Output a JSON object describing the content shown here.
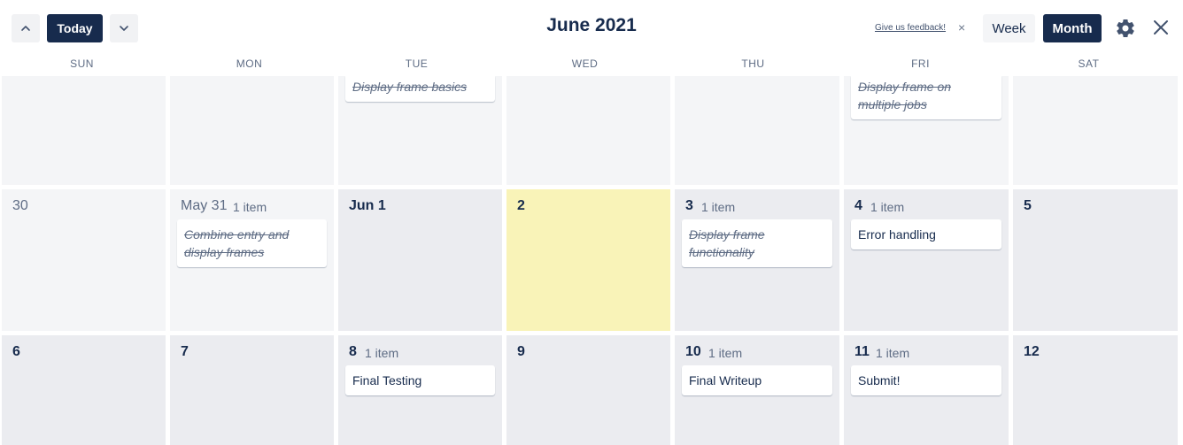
{
  "header": {
    "today_label": "Today",
    "title": "June 2021",
    "feedback_label": "Give us feedback!",
    "feedback_close": "×",
    "week_label": "Week",
    "month_label": "Month"
  },
  "weekdays": [
    "SUN",
    "MON",
    "TUE",
    "WED",
    "THU",
    "FRI",
    "SAT"
  ],
  "week1": {
    "tue_card": "Display frame basics",
    "fri_card": "Display frame on multiple jobs"
  },
  "week2": {
    "sun": {
      "date": "30"
    },
    "mon": {
      "date": "May 31",
      "count": "1 item",
      "card": "Combine entry and display frames"
    },
    "tue": {
      "date": "Jun 1"
    },
    "wed": {
      "date": "2"
    },
    "thu": {
      "date": "3",
      "count": "1 item",
      "card": "Display frame functionality"
    },
    "fri": {
      "date": "4",
      "count": "1 item",
      "card": "Error handling"
    },
    "sat": {
      "date": "5"
    }
  },
  "week3": {
    "sun": {
      "date": "6"
    },
    "mon": {
      "date": "7"
    },
    "tue": {
      "date": "8",
      "count": "1 item",
      "card": "Final Testing"
    },
    "wed": {
      "date": "9"
    },
    "thu": {
      "date": "10",
      "count": "1 item",
      "card": "Final Writeup"
    },
    "fri": {
      "date": "11",
      "count": "1 item",
      "card": "Submit!"
    },
    "sat": {
      "date": "12"
    }
  },
  "colors": {
    "accent": "#172b4d",
    "today_highlight": "#f9f3b8",
    "cell": "#ebecf0",
    "cell_past": "#f4f5f7"
  },
  "icons": {
    "prev": "chevron-up-icon",
    "next": "chevron-down-icon",
    "settings": "gear-icon",
    "close": "close-icon"
  }
}
